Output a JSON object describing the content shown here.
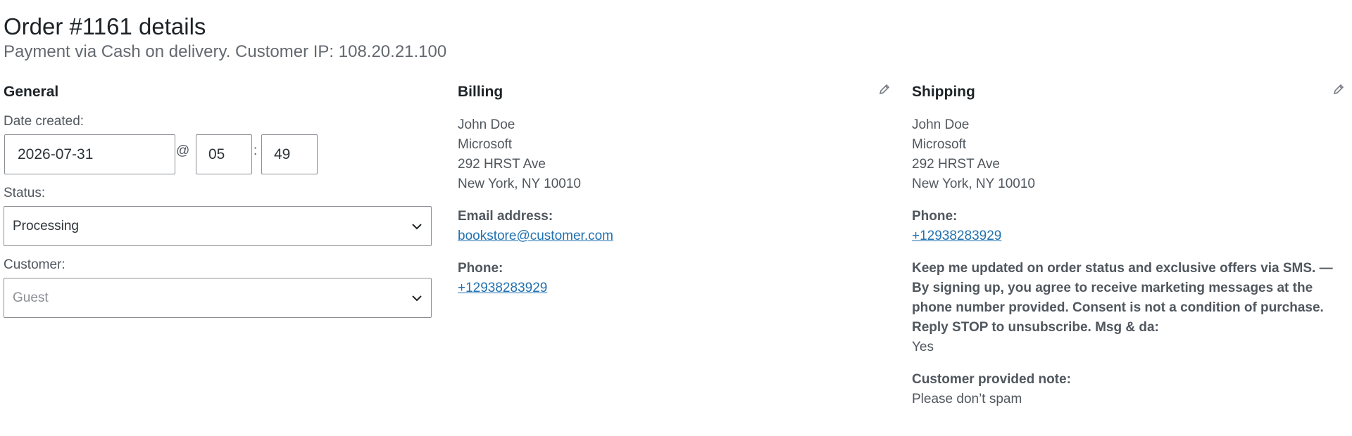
{
  "header": {
    "title": "Order #1161 details",
    "subtitle": "Payment via Cash on delivery. Customer IP: 108.20.21.100"
  },
  "general": {
    "heading": "General",
    "date_label": "Date created:",
    "date_value": "2026-07-31",
    "at_symbol": "@",
    "hour_value": "05",
    "colon": ":",
    "minute_value": "49",
    "status_label": "Status:",
    "status_value": "Processing",
    "customer_label": "Customer:",
    "customer_placeholder": "Guest"
  },
  "billing": {
    "heading": "Billing",
    "address": [
      "John Doe",
      "Microsoft",
      "292 HRST Ave",
      "New York, NY 10010"
    ],
    "email_label": "Email address:",
    "email_value": "bookstore@customer.com",
    "phone_label": "Phone:",
    "phone_value": "+12938283929"
  },
  "shipping": {
    "heading": "Shipping",
    "address": [
      "John Doe",
      "Microsoft",
      "292 HRST Ave",
      "New York, NY 10010"
    ],
    "phone_label": "Phone:",
    "phone_value": "+12938283929",
    "sms_label": "Keep me updated on order status and exclusive offers via SMS. — By signing up, you agree to receive marketing messages at the phone number provided. Consent is not a condition of purchase. Reply STOP to unsubscribe. Msg & da:",
    "sms_value": "Yes",
    "note_label": "Customer provided note:",
    "note_value": "Please don’t spam"
  },
  "icons": {
    "edit": "pencil-icon",
    "dropdown": "chevron-down-icon"
  },
  "colors": {
    "link": "#2271b1",
    "text": "#50575e",
    "heading": "#1d2327",
    "border": "#8c8f94"
  }
}
